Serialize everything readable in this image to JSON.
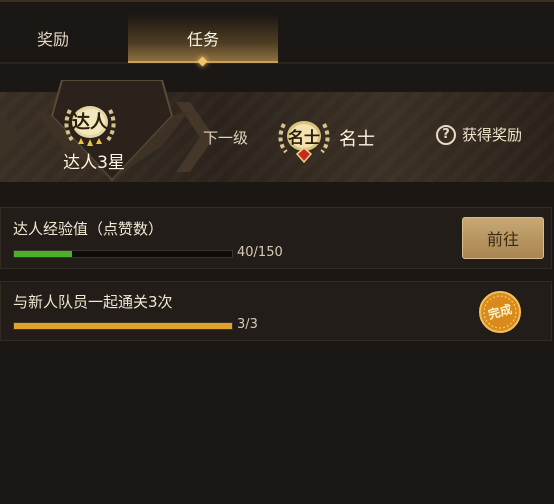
{
  "tabs": [
    {
      "label": "奖励"
    },
    {
      "label": "任务"
    }
  ],
  "rank": {
    "badge_text": "达人",
    "title": "达人3星",
    "stars": 3
  },
  "next_level": {
    "label": "下一级",
    "badge_text": "名士",
    "name": "名士"
  },
  "help": {
    "icon_glyph": "?",
    "label": "获得奖励"
  },
  "tasks": [
    {
      "title": "达人经验值（点赞数）",
      "progress_text": "40/150",
      "progress": 0.267,
      "bar_color": "#4caf2a",
      "button_label": "前往"
    },
    {
      "title": "与新人队员一起通关3次",
      "progress_text": "3/3",
      "progress": 1.0,
      "bar_color": "#e0a32a",
      "stamp_text": "完成"
    }
  ],
  "colors": {
    "background": "#1b1714",
    "accent_gold": "#c9a15a"
  }
}
